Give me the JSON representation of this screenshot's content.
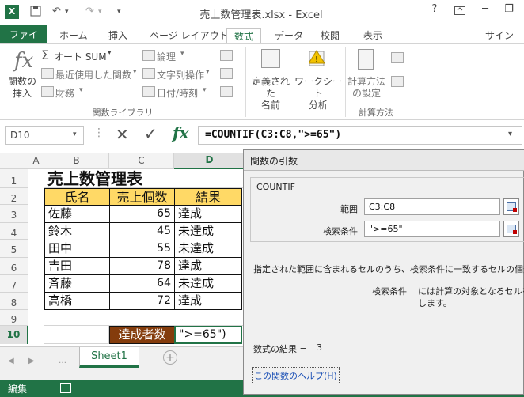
{
  "window": {
    "title": "売上数管理表.xlsx - Excel",
    "user": "サインイン"
  },
  "tabs": [
    "ファイル",
    "ホーム",
    "挿入",
    "ページ レイアウト",
    "数式",
    "データ",
    "校閲",
    "表示"
  ],
  "active_tab": "数式",
  "ribbon": {
    "insert_function": "関数の\n挿入",
    "autosum": "オート SUM",
    "recent": "最近使用した関数",
    "financial": "財務",
    "logical": "論理",
    "text": "文字列操作",
    "datetime": "日付/時刻",
    "library_group": "関数ライブラリ",
    "defined_names": "定義された\n名前",
    "worksheet_analysis": "ワークシート\n分析",
    "calc_options": "計算方法\nの設定",
    "calc_group": "計算方法",
    "fx_icon": "fx"
  },
  "formula_bar": {
    "name_box": "D10",
    "formula": "=COUNTIF(C3:C8,\">=65\")",
    "fx": "fx"
  },
  "grid": {
    "columns": [
      "A",
      "B",
      "C",
      "D"
    ],
    "rows": [
      "1",
      "2",
      "3",
      "4",
      "5",
      "6",
      "7",
      "8",
      "9",
      "10"
    ],
    "title": "売上数管理表",
    "headers": [
      "氏名",
      "売上個数",
      "結果"
    ],
    "data": [
      {
        "name": "佐藤",
        "qty": "65",
        "result": "達成"
      },
      {
        "name": "鈴木",
        "qty": "45",
        "result": "未達成"
      },
      {
        "name": "田中",
        "qty": "55",
        "result": "未達成"
      },
      {
        "name": "吉田",
        "qty": "78",
        "result": "達成"
      },
      {
        "name": "斉藤",
        "qty": "64",
        "result": "未達成"
      },
      {
        "name": "高橋",
        "qty": "72",
        "result": "達成"
      }
    ],
    "summary_label": "達成者数",
    "summary_cell": "\">=65\")"
  },
  "sheet_tab": "Sheet1",
  "status": "編集",
  "dialog": {
    "title": "関数の引数",
    "function": "COUNTIF",
    "arg1_label": "範囲",
    "arg1_value": "C3:C8",
    "arg2_label": "検索条件",
    "arg2_value": "\">=65\"",
    "description": "指定された範囲に含まれるセルのうち、検索条件に一致するセルの個数を",
    "arg_help_label": "検索条件",
    "arg_help_line1": "には計算の対象となるセルを定",
    "arg_help_line2": "します。",
    "result_label": "数式の結果 =",
    "result_value": "3",
    "help_link": "この関数のヘルプ(H)"
  },
  "colors": {
    "excel_green": "#217346",
    "header_yellow": "#ffd966",
    "label_brown": "#843c0c"
  }
}
